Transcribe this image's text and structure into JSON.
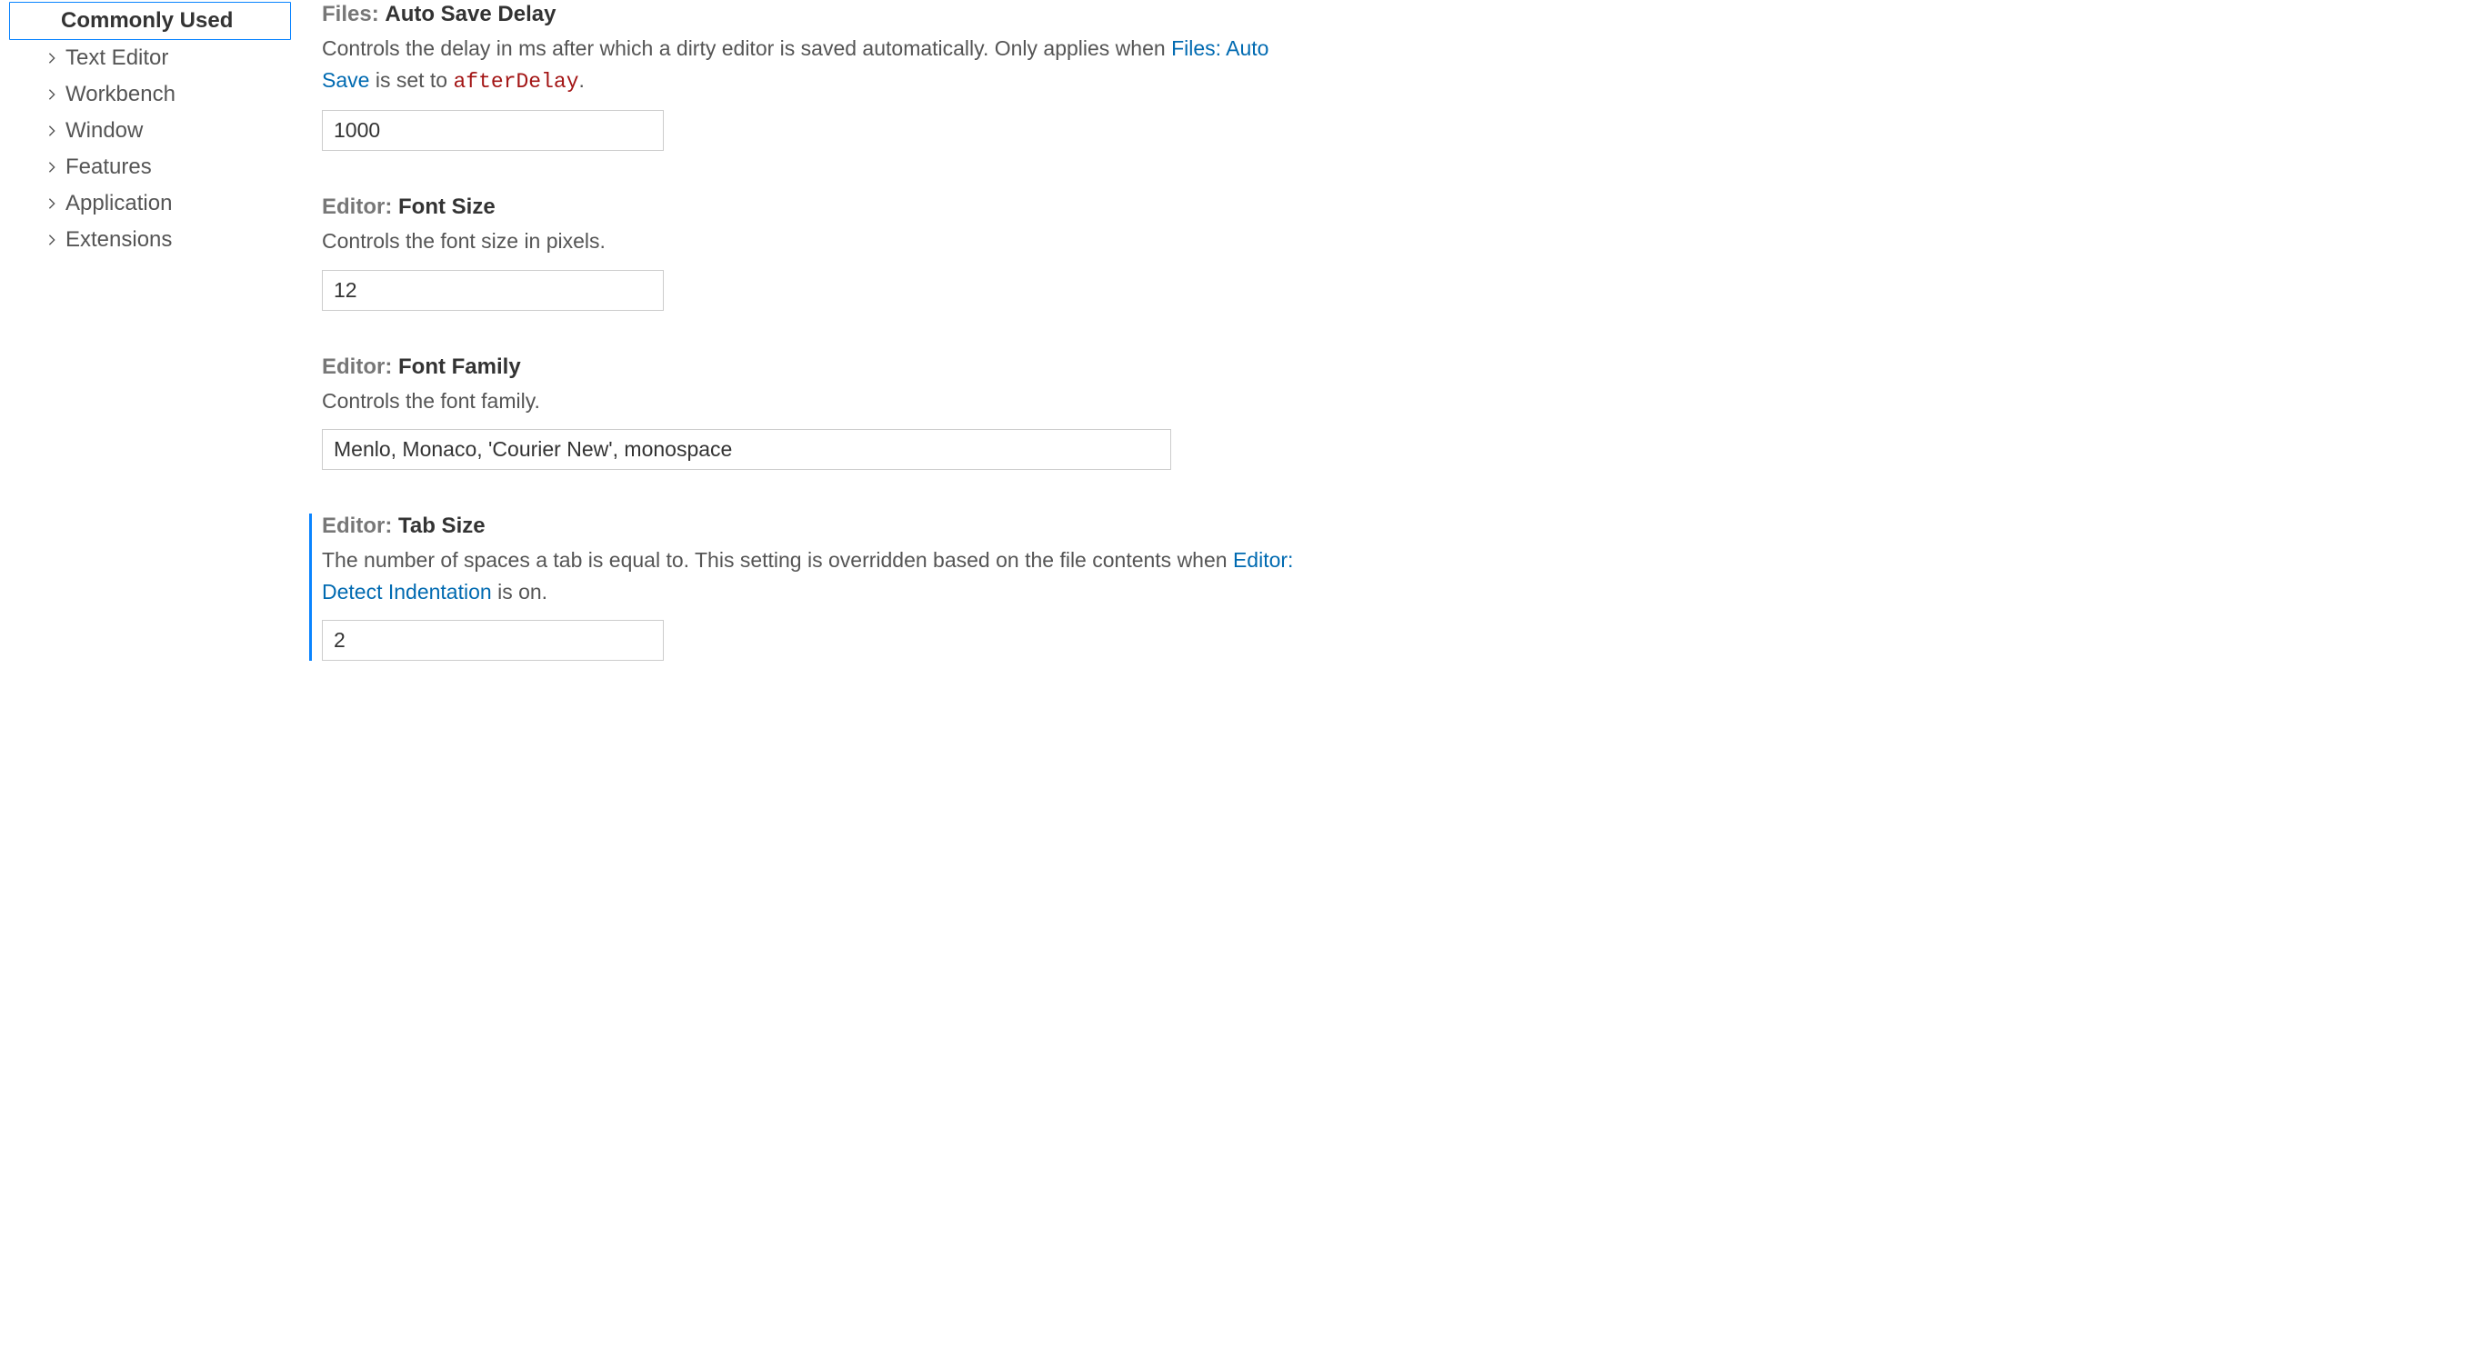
{
  "sidebar": {
    "items": [
      {
        "label": "Commonly Used",
        "selected": true,
        "expandable": false
      },
      {
        "label": "Text Editor",
        "selected": false,
        "expandable": true
      },
      {
        "label": "Workbench",
        "selected": false,
        "expandable": true
      },
      {
        "label": "Window",
        "selected": false,
        "expandable": true
      },
      {
        "label": "Features",
        "selected": false,
        "expandable": true
      },
      {
        "label": "Application",
        "selected": false,
        "expandable": true
      },
      {
        "label": "Extensions",
        "selected": false,
        "expandable": true
      }
    ]
  },
  "settings": {
    "autoSaveDelay": {
      "prefix": "Files: ",
      "name": "Auto Save Delay",
      "desc_before": "Controls the delay in ms after which a dirty editor is saved automatically. Only applies when ",
      "link": "Files: Auto Save",
      "desc_mid": " is set to ",
      "code": "afterDelay",
      "desc_after": ".",
      "value": "1000"
    },
    "fontSize": {
      "prefix": "Editor: ",
      "name": "Font Size",
      "desc": "Controls the font size in pixels.",
      "value": "12"
    },
    "fontFamily": {
      "prefix": "Editor: ",
      "name": "Font Family",
      "desc": "Controls the font family.",
      "value": "Menlo, Monaco, 'Courier New', monospace"
    },
    "tabSize": {
      "prefix": "Editor: ",
      "name": "Tab Size",
      "desc_before": "The number of spaces a tab is equal to. This setting is overridden based on the file contents when ",
      "link": "Editor: Detect Indentation",
      "desc_after": " is on.",
      "value": "2"
    }
  }
}
